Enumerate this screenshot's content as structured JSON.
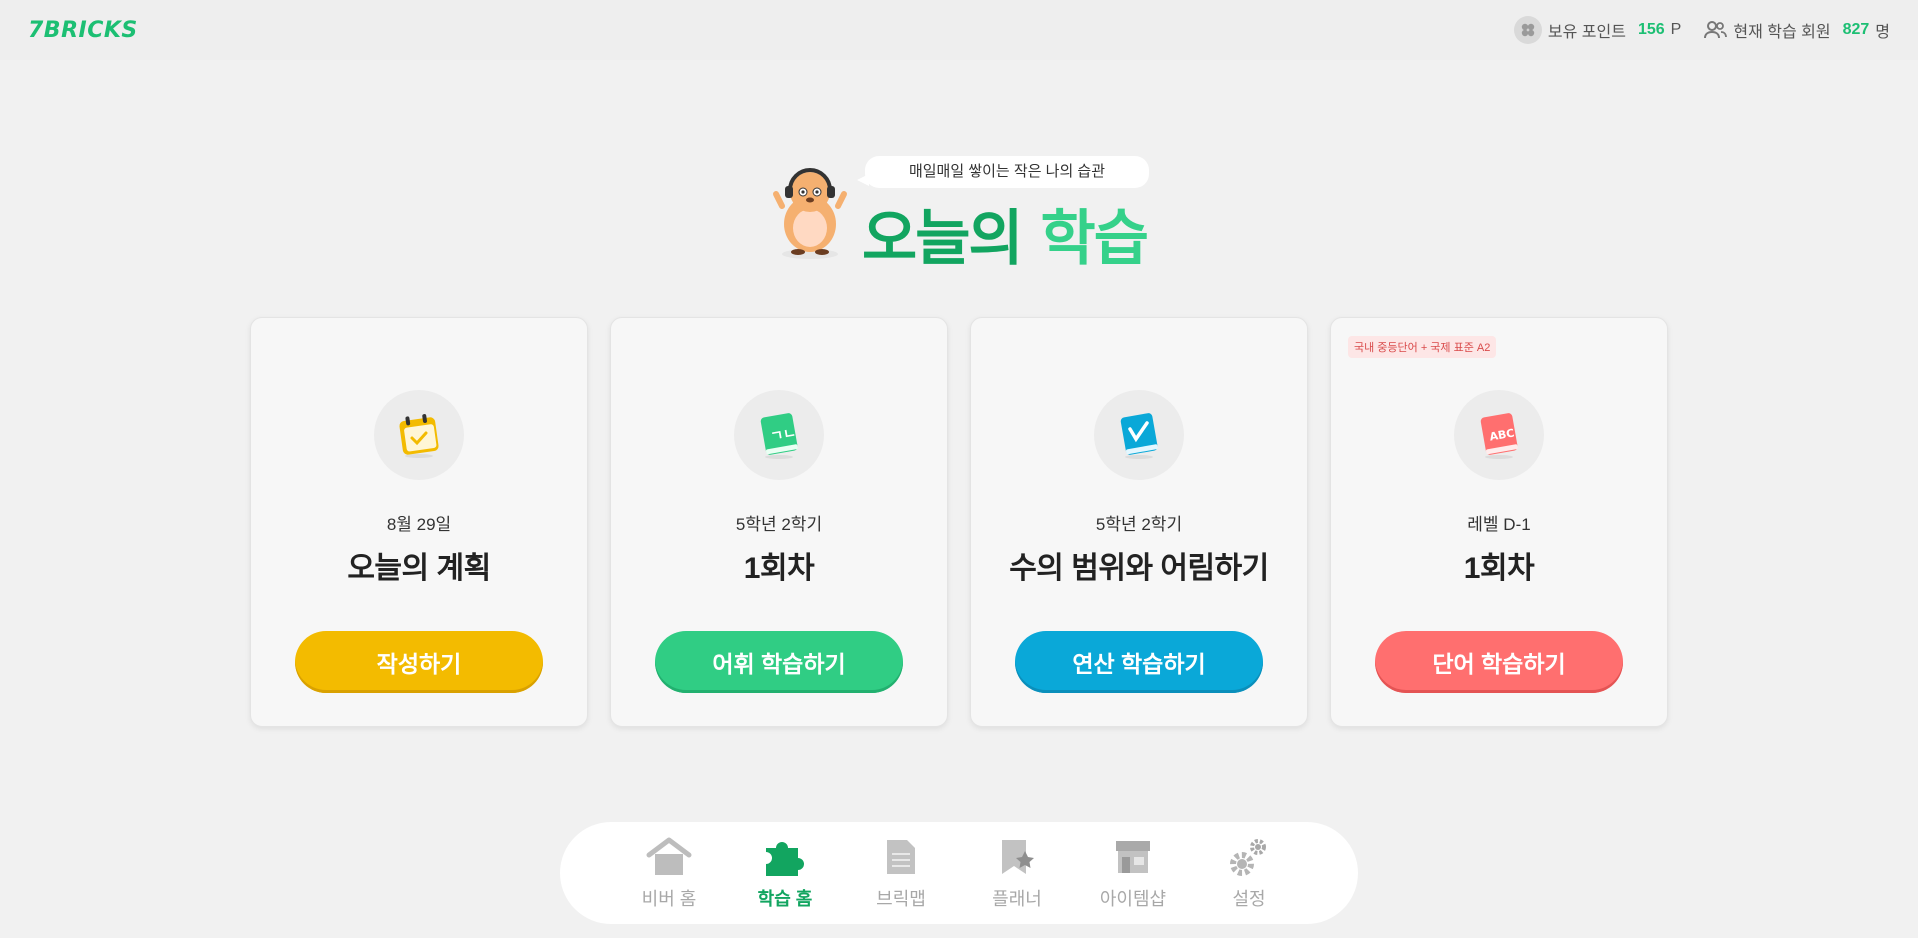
{
  "header": {
    "logo_text": "7BRICKS",
    "points_label": "보유 포인트",
    "points_value": "156",
    "points_unit": "P",
    "members_label": "현재 학습 회원",
    "members_value": "827",
    "members_unit": "명"
  },
  "hero": {
    "bubble_text": "매일매일 쌓이는 작은 나의 습관",
    "title_part1": "오늘의",
    "title_part2": "학습"
  },
  "cards": [
    {
      "tag": "",
      "subtitle": "8월 29일",
      "title": "오늘의 계획",
      "button": "작성하기",
      "color": "#f3bb00",
      "icon": "calendar-check-icon"
    },
    {
      "tag": "",
      "subtitle": "5학년 2학기",
      "title": "1회차",
      "button": "어휘 학습하기",
      "color": "#30cd84",
      "icon": "korean-book-icon"
    },
    {
      "tag": "",
      "subtitle": "5학년 2학기",
      "title": "수의 범위와 어림하기",
      "button": "연산 학습하기",
      "color": "#0aa8d8",
      "icon": "math-book-icon"
    },
    {
      "tag": "국내 중등단어 + 국제 표준 A2",
      "subtitle": "레벨 D-1",
      "title": "1회차",
      "button": "단어 학습하기",
      "color": "#ff6f6f",
      "icon": "abc-book-icon"
    }
  ],
  "nav": [
    {
      "label": "비버 홈",
      "icon": "house-icon",
      "active": false
    },
    {
      "label": "학습 홈",
      "icon": "puzzle-icon",
      "active": true
    },
    {
      "label": "브릭맵",
      "icon": "document-icon",
      "active": false
    },
    {
      "label": "플래너",
      "icon": "bookmark-star-icon",
      "active": false
    },
    {
      "label": "아이템샵",
      "icon": "shop-icon",
      "active": false
    },
    {
      "label": "설정",
      "icon": "gear-icon",
      "active": false
    }
  ]
}
